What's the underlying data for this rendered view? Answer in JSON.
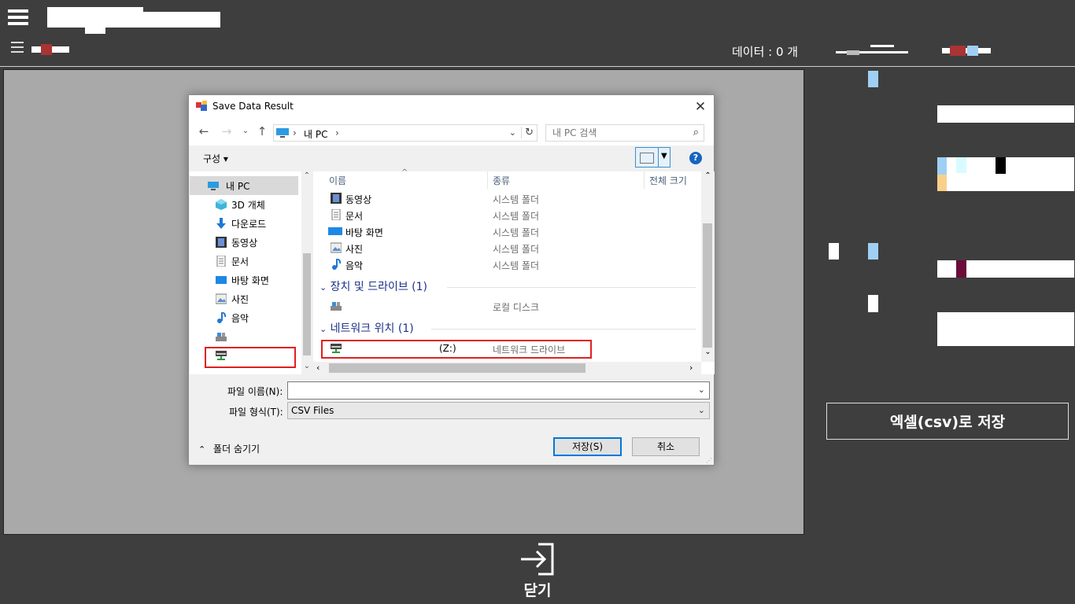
{
  "header": {
    "data_count": "데이터 : 0 개"
  },
  "right_panel": {
    "save_csv_label": "엑셀(csv)로 저장"
  },
  "footer": {
    "close_label": "닫기"
  },
  "dialog": {
    "title": "Save Data Result",
    "address_path": "내 PC",
    "search_placeholder": "내 PC 검색",
    "organize_label": "구성 ▾",
    "help_label": "?",
    "nav_items": [
      {
        "label": "내 PC",
        "icon": "pc-icon"
      },
      {
        "label": "3D 개체",
        "icon": "3d-objects-icon"
      },
      {
        "label": "다운로드",
        "icon": "download-icon"
      },
      {
        "label": "동영상",
        "icon": "video-icon"
      },
      {
        "label": "문서",
        "icon": "document-icon"
      },
      {
        "label": "바탕 화면",
        "icon": "desktop-icon"
      },
      {
        "label": "사진",
        "icon": "picture-icon"
      },
      {
        "label": "음악",
        "icon": "music-icon"
      },
      {
        "label": "",
        "icon": "local-disk-icon"
      },
      {
        "label": "",
        "icon": "network-drive-icon"
      }
    ],
    "columns": [
      "이름",
      "종류",
      "전체 크기"
    ],
    "folders": [
      {
        "name": "동영상",
        "type": "시스템 폴더",
        "icon": "video-icon"
      },
      {
        "name": "문서",
        "type": "시스템 폴더",
        "icon": "document-icon"
      },
      {
        "name": "바탕 화면",
        "type": "시스템 폴더",
        "icon": "desktop-icon"
      },
      {
        "name": "사진",
        "type": "시스템 폴더",
        "icon": "picture-icon"
      },
      {
        "name": "음악",
        "type": "시스템 폴더",
        "icon": "music-icon"
      }
    ],
    "group_devices": "장치 및 드라이브 (1)",
    "local_disk_type": "로컬 디스크",
    "group_network": "네트워크 위치 (1)",
    "network_drive_letter": "(Z:)",
    "network_drive_type": "네트워크 드라이브",
    "filename_label": "파일 이름(N):",
    "filename_value": "",
    "filetype_label": "파일 형식(T):",
    "filetype_value": "CSV Files",
    "hide_folders_label": "폴더 숨기기",
    "save_label": "저장(S)",
    "cancel_label": "취소"
  }
}
